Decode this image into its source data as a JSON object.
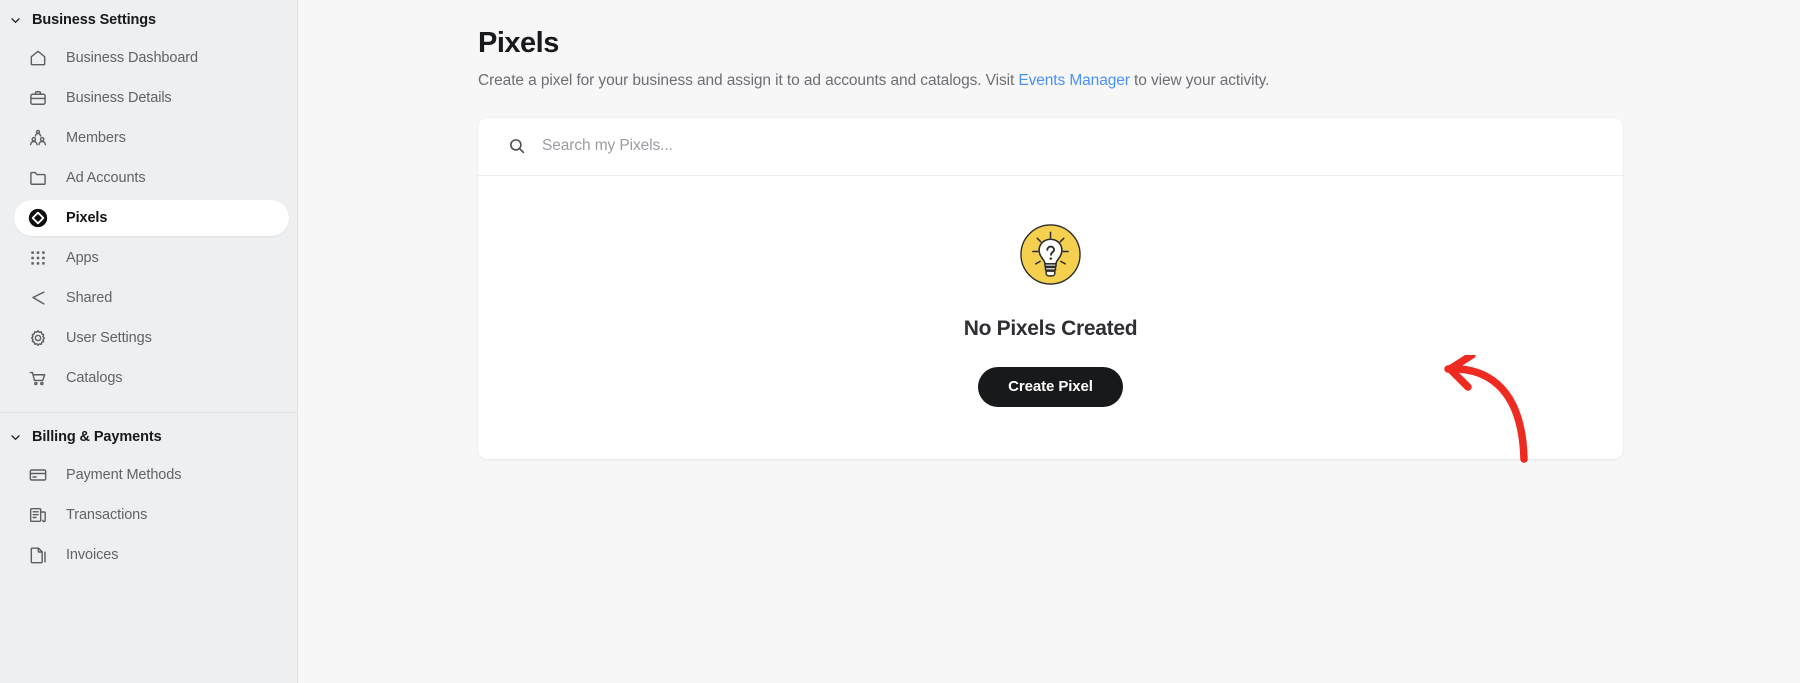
{
  "sidebar": {
    "sections": [
      {
        "title": "Business Settings",
        "chevron": "chevron-down-icon",
        "items": [
          {
            "label": "Business Dashboard",
            "icon": "home-icon",
            "active": false
          },
          {
            "label": "Business Details",
            "icon": "briefcase-icon",
            "active": false
          },
          {
            "label": "Members",
            "icon": "members-icon",
            "active": false
          },
          {
            "label": "Ad Accounts",
            "icon": "folder-icon",
            "active": false
          },
          {
            "label": "Pixels",
            "icon": "pixel-diamond-icon",
            "active": true
          },
          {
            "label": "Apps",
            "icon": "grid-apps-icon",
            "active": false
          },
          {
            "label": "Shared",
            "icon": "share-icon",
            "active": false
          },
          {
            "label": "User Settings",
            "icon": "gear-icon",
            "active": false
          },
          {
            "label": "Catalogs",
            "icon": "shopping-cart-icon",
            "active": false
          }
        ]
      },
      {
        "title": "Billing & Payments",
        "chevron": "chevron-down-icon",
        "items": [
          {
            "label": "Payment Methods",
            "icon": "credit-card-icon",
            "active": false
          },
          {
            "label": "Transactions",
            "icon": "transactions-icon",
            "active": false
          },
          {
            "label": "Invoices",
            "icon": "invoice-icon",
            "active": false
          }
        ]
      }
    ]
  },
  "main": {
    "title": "Pixels",
    "subtitle_before": "Create a pixel for your business and assign it to ad accounts and catalogs. Visit ",
    "subtitle_link": "Events Manager",
    "subtitle_after": " to view your activity.",
    "search": {
      "placeholder": "Search my Pixels...",
      "value": "",
      "icon": "search-icon"
    },
    "empty_state": {
      "icon": "lightbulb-question-icon",
      "icon_color": "#f5d04e",
      "title": "No Pixels Created",
      "button_label": "Create Pixel"
    },
    "annotation": {
      "type": "red-curved-arrow",
      "color": "#ee2b21",
      "points_to": "Create Pixel"
    }
  },
  "colors": {
    "sidebar_bg": "#eeeff0",
    "main_bg": "#f7f7f8",
    "card_bg": "#ffffff",
    "accent_link": "#4a90f7",
    "button_bg": "#18191b",
    "annotation_red": "#ee2b21",
    "bulb_yellow": "#f5d04e"
  }
}
